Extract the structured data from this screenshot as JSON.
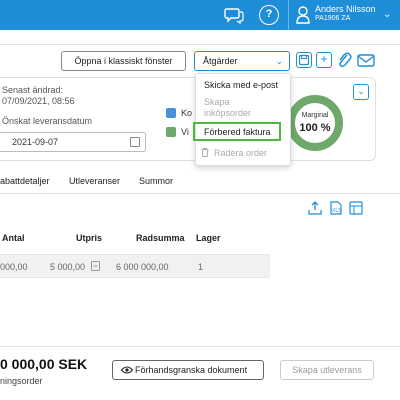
{
  "topbar": {
    "user_name": "Anders Nilsson",
    "user_org": "PA1906 ZA",
    "help_glyph": "?",
    "icons": [
      "chat-icon",
      "help-icon",
      "user-icon",
      "chevron-down-icon"
    ]
  },
  "toolbar": {
    "classic_button": "Öppna i klassiskt fönster",
    "actions_button": "Åtgärder",
    "icon_buttons": [
      "save-icon",
      "add-icon",
      "attach-icon",
      "email-icon"
    ]
  },
  "dropdown": {
    "items": [
      {
        "label": "Skicka med e-post",
        "enabled": true
      },
      {
        "label": "Skapa inköpsorder",
        "enabled": false
      },
      {
        "label": "Förbered faktura",
        "enabled": true,
        "highlighted": true
      },
      {
        "label": "Radera order",
        "enabled": false
      }
    ]
  },
  "info": {
    "last_changed_label": "Senast ändrad:",
    "last_changed_value": "07/09/2021, 08:56",
    "delivery_date_label": "Önskat leveransdatum",
    "delivery_date_value": "2021-09-07",
    "legend": [
      {
        "text": "Ko",
        "color": "#4a90d9"
      },
      {
        "text": "Vi",
        "color": "#6ea86a"
      }
    ],
    "margin_title": "Marginal",
    "margin_value": "100 %",
    "margin_fraction": 1.0,
    "margin_color": "#6ea86a"
  },
  "tabs": [
    "abattdetaljer",
    "Utleveranser",
    "Summor"
  ],
  "table": {
    "headers": [
      "Antal",
      "Utpris",
      "Radsumma",
      "Lager"
    ],
    "row": [
      "000,00",
      "5 000,00",
      "6 000 000,00",
      "1"
    ]
  },
  "footer": {
    "total": "0 000,00 SEK",
    "total_sub": "ningsorder",
    "preview_button": "Förhandsgranska dokument",
    "delivery_button": "Skapa utleverans"
  },
  "colors": {
    "accent": "#1f8ed8",
    "highlight": "#4cba3f"
  }
}
